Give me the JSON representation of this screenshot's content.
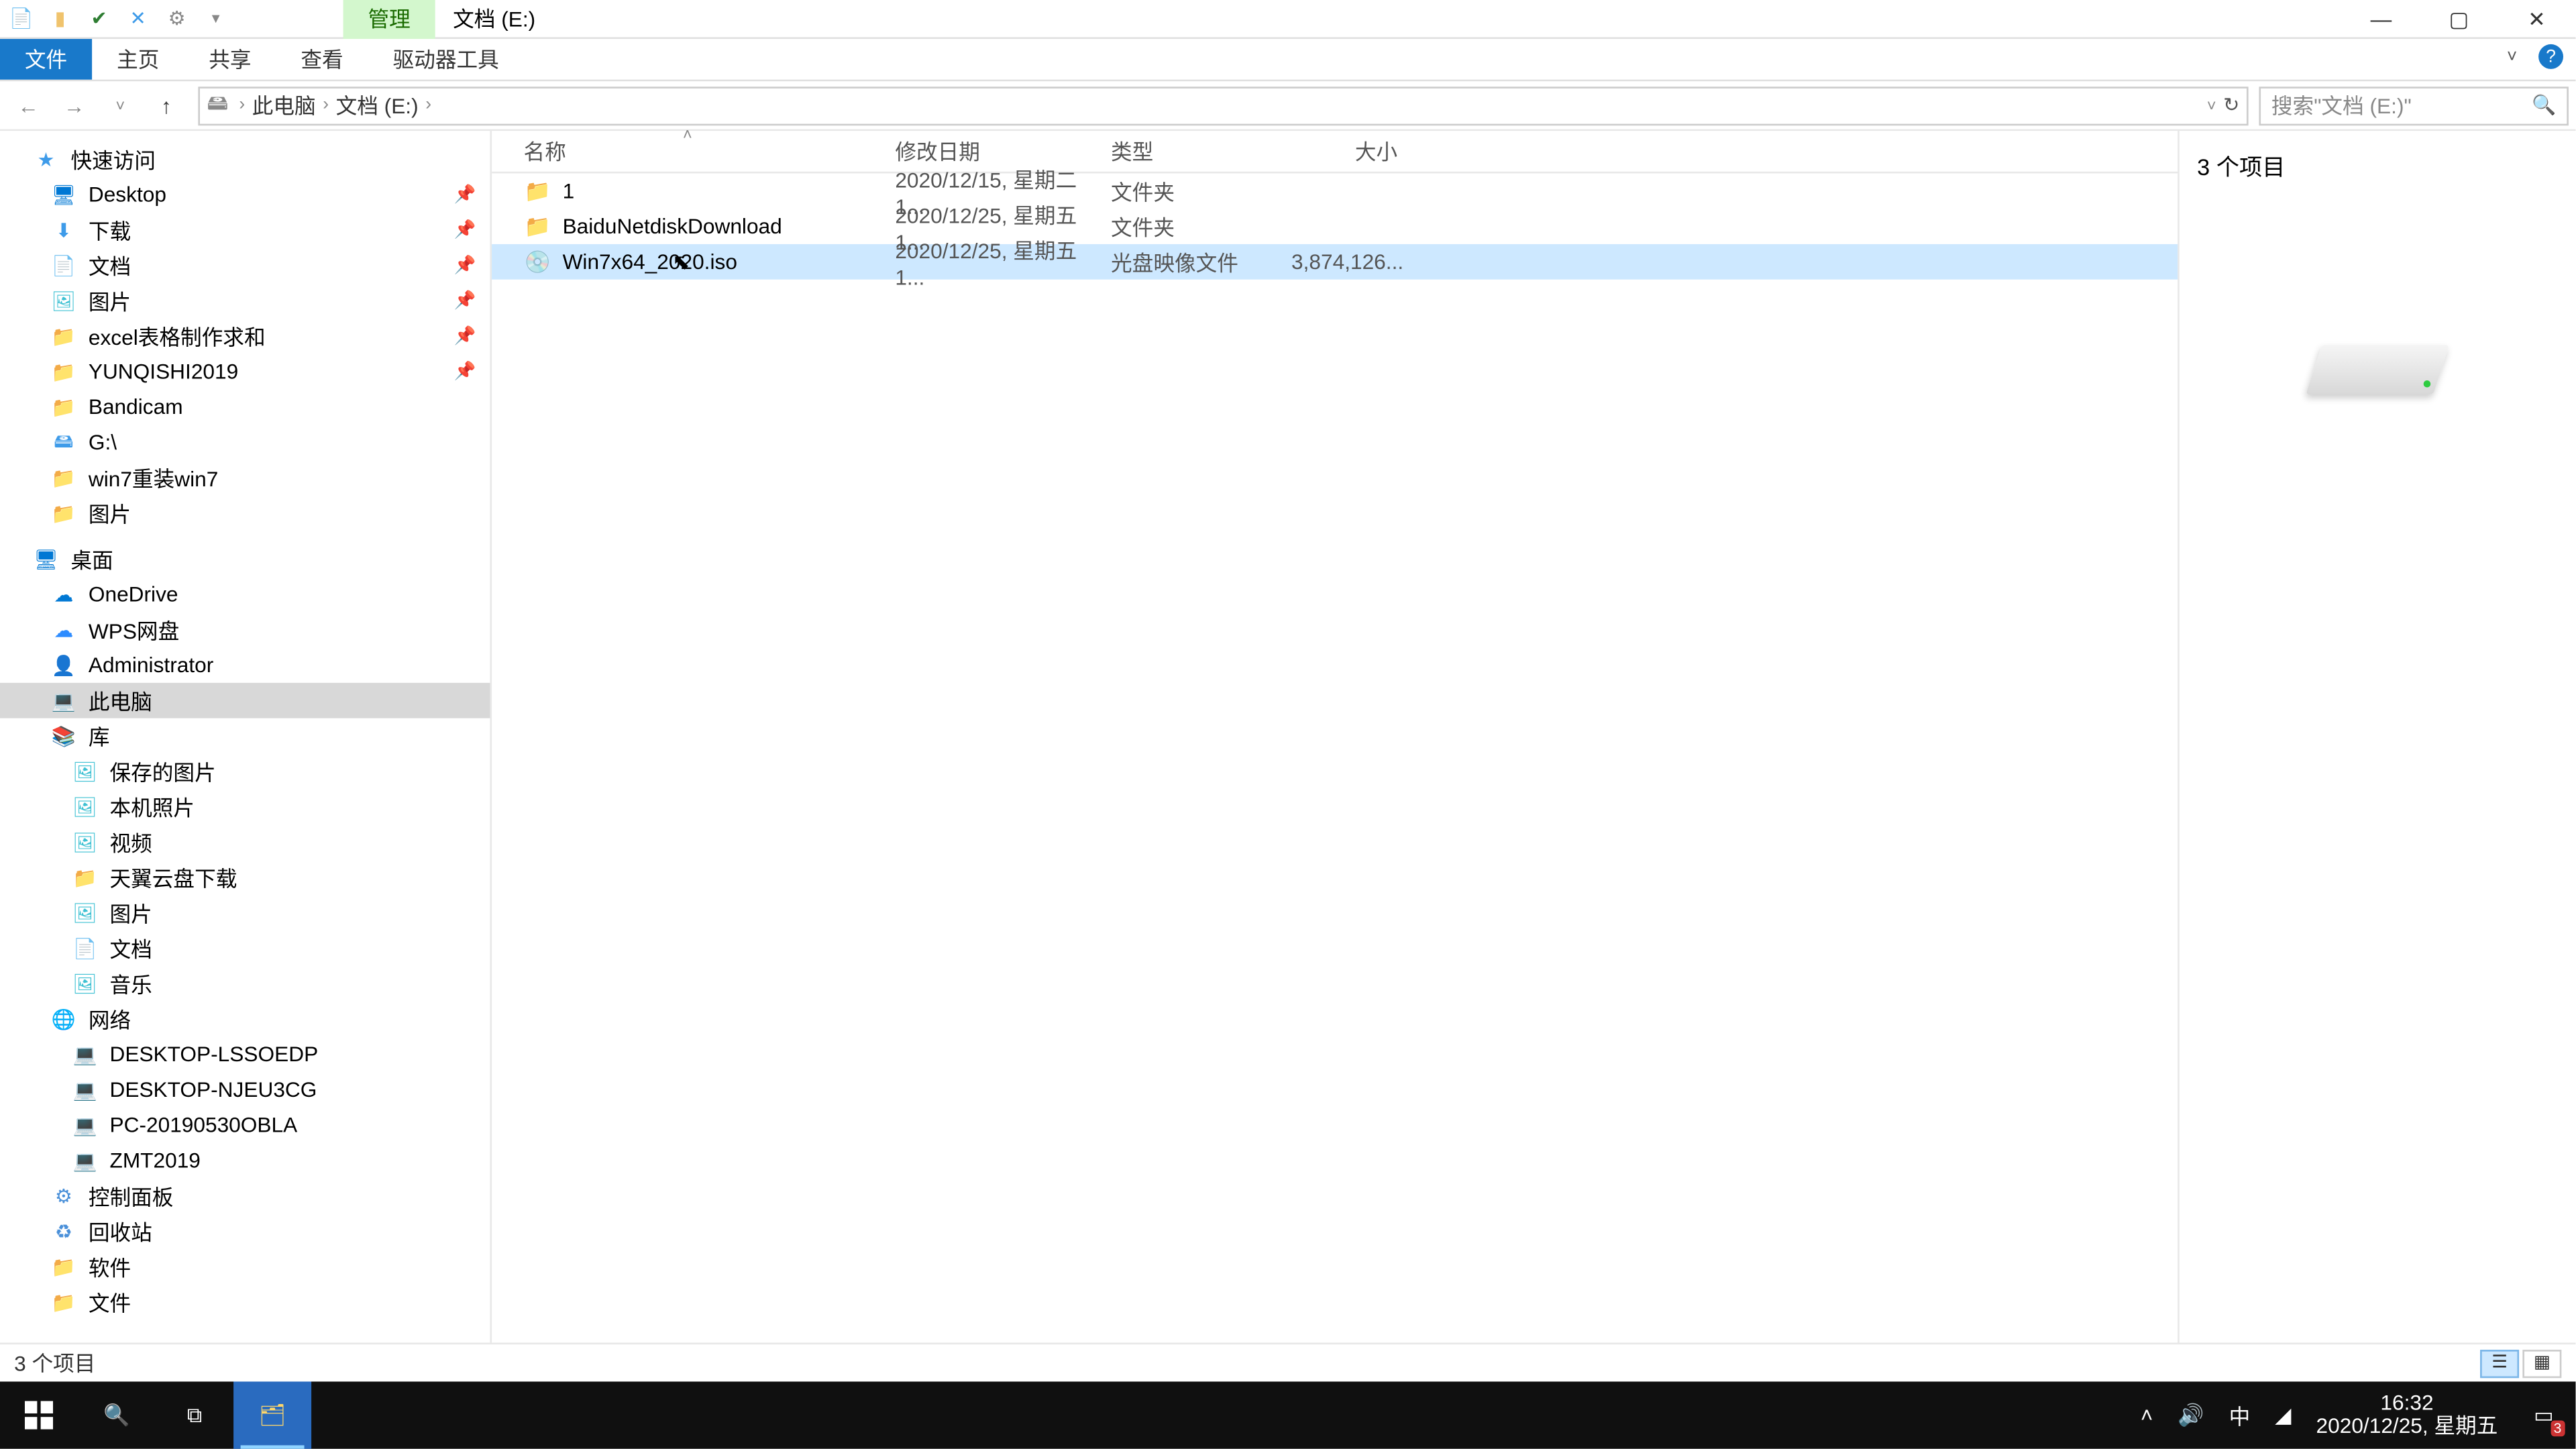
{
  "title": "文档 (E:)",
  "ribbon": {
    "context_tab": "管理",
    "tabs": [
      "文件",
      "主页",
      "共享",
      "查看",
      "驱动器工具"
    ]
  },
  "window_ctrls": {
    "min": "—",
    "max": "▢",
    "close": "✕"
  },
  "breadcrumb": [
    "此电脑",
    "文档 (E:)"
  ],
  "search_placeholder": "搜索\"文档 (E:)\"",
  "tree": {
    "groups": [
      {
        "label": "快速访问",
        "icon": "star",
        "items": [
          {
            "label": "Desktop",
            "icon": "desktop",
            "pin": true
          },
          {
            "label": "下载",
            "icon": "download",
            "pin": true
          },
          {
            "label": "文档",
            "icon": "doc",
            "pin": true
          },
          {
            "label": "图片",
            "icon": "pic",
            "pin": true
          },
          {
            "label": "excel表格制作求和",
            "icon": "folder",
            "pin": true
          },
          {
            "label": "YUNQISHI2019",
            "icon": "folder",
            "pin": true
          },
          {
            "label": "Bandicam",
            "icon": "folder"
          },
          {
            "label": "G:\\",
            "icon": "drive"
          },
          {
            "label": "win7重装win7",
            "icon": "folder"
          },
          {
            "label": "图片",
            "icon": "folder"
          }
        ]
      },
      {
        "label": "桌面",
        "icon": "desktop",
        "items": [
          {
            "label": "OneDrive",
            "icon": "onedrive"
          },
          {
            "label": "WPS网盘",
            "icon": "wps"
          },
          {
            "label": "Administrator",
            "icon": "user"
          },
          {
            "label": "此电脑",
            "icon": "pc",
            "selected": true
          },
          {
            "label": "库",
            "icon": "lib",
            "items": [
              {
                "label": "保存的图片",
                "icon": "pic"
              },
              {
                "label": "本机照片",
                "icon": "pic"
              },
              {
                "label": "视频",
                "icon": "pic"
              },
              {
                "label": "天翼云盘下载",
                "icon": "folder"
              },
              {
                "label": "图片",
                "icon": "pic"
              },
              {
                "label": "文档",
                "icon": "doc"
              },
              {
                "label": "音乐",
                "icon": "pic"
              }
            ]
          },
          {
            "label": "网络",
            "icon": "net",
            "items": [
              {
                "label": "DESKTOP-LSSOEDP",
                "icon": "pc"
              },
              {
                "label": "DESKTOP-NJEU3CG",
                "icon": "pc"
              },
              {
                "label": "PC-20190530OBLA",
                "icon": "pc"
              },
              {
                "label": "ZMT2019",
                "icon": "pc"
              }
            ]
          },
          {
            "label": "控制面板",
            "icon": "cp"
          },
          {
            "label": "回收站",
            "icon": "recycle"
          },
          {
            "label": "软件",
            "icon": "folder"
          },
          {
            "label": "文件",
            "icon": "folder"
          }
        ]
      }
    ]
  },
  "columns": {
    "name": "名称",
    "date": "修改日期",
    "type": "类型",
    "size": "大小"
  },
  "files": [
    {
      "name": "1",
      "date": "2020/12/15, 星期二 1...",
      "type": "文件夹",
      "size": "",
      "icon": "folder"
    },
    {
      "name": "BaiduNetdiskDownload",
      "date": "2020/12/25, 星期五 1...",
      "type": "文件夹",
      "size": "",
      "icon": "folder"
    },
    {
      "name": "Win7x64_2020.iso",
      "date": "2020/12/25, 星期五 1...",
      "type": "光盘映像文件",
      "size": "3,874,126...",
      "icon": "iso",
      "selected": true
    }
  ],
  "preview": {
    "heading": "3 个项目"
  },
  "status": {
    "text": "3 个项目"
  },
  "taskbar": {
    "time": "16:32",
    "date": "2020/12/25, 星期五",
    "ime": "中",
    "notif_count": "3"
  }
}
